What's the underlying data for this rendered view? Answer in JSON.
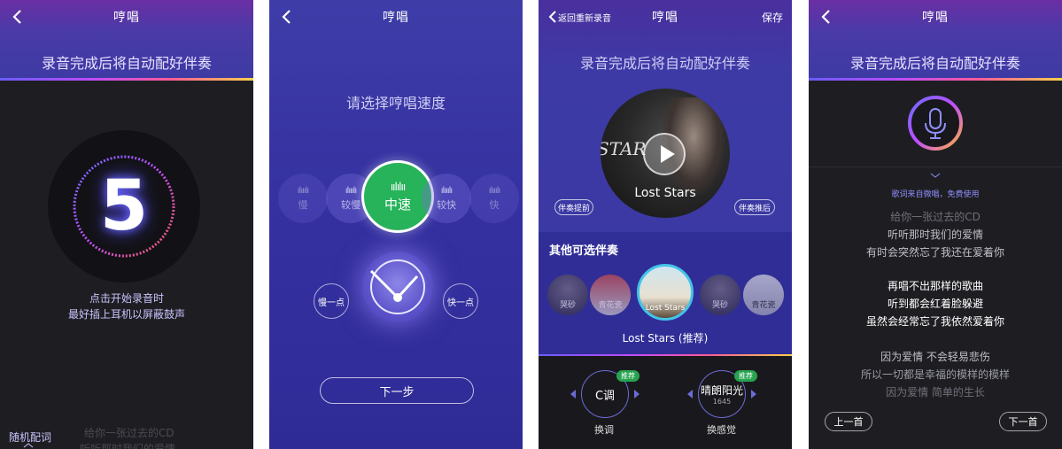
{
  "colors": {
    "accent": "#6c6cff",
    "green": "#27b35a",
    "header": "#4a3aa8",
    "dark_bg": "#1e1e22"
  },
  "screen1": {
    "title": "哼唱",
    "subtitle": "录音完成后将自动配好伴奏",
    "countdown": "5",
    "hint_line1": "点击开始录音时",
    "hint_line2": "最好插上耳机以屏蔽鼓声",
    "random_lyrics_label": "随机配词",
    "faint_lyric1": "给你一张过去的CD",
    "faint_lyric2": "听听那时我们的爱情"
  },
  "screen2": {
    "title": "哼唱",
    "prompt": "请选择哼唱速度",
    "speeds": [
      "慢",
      "较慢",
      "中速",
      "较快",
      "快"
    ],
    "selected_speed": "中速",
    "slower_label": "慢一点",
    "faster_label": "快一点",
    "next_label": "下一步"
  },
  "screen3": {
    "back_label": "返回重新录音",
    "title": "哼唱",
    "save_label": "保存",
    "subtitle": "录音完成后将自动配好伴奏",
    "song_title": "Lost Stars",
    "album_text": "STAR",
    "advance_label": "伴奏提前",
    "delay_label": "伴奏推后",
    "other_title": "其他可选伴奏",
    "thumbs": [
      "哭砂",
      "青花瓷",
      "Lost Stars",
      "哭砂",
      "青花瓷"
    ],
    "current_label": "Lost Stars (推荐)",
    "key_value": "C调",
    "key_badge": "推荐",
    "key_label": "换调",
    "mood_value": "晴朗阳光",
    "mood_sub": "1645",
    "mood_badge": "推荐",
    "mood_label": "换感觉"
  },
  "screen4": {
    "title": "哼唱",
    "subtitle": "录音完成后将自动配好伴奏",
    "lyrics_source": "歌词来自微唱，免费使用",
    "lyrics": [
      "给你一张过去的CD",
      "听听那时我们的爱情",
      "有时会突然忘了我还在爱着你",
      "再唱不出那样的歌曲",
      "听到都会红着脸躲避",
      "虽然会经常忘了我依然爱着你",
      "因为爱情 不会轻易悲伤",
      "所以一切都是幸福的模样的模样",
      "因为爱情 简单的生长"
    ],
    "prev_label": "上一首",
    "next_label": "下一首"
  }
}
